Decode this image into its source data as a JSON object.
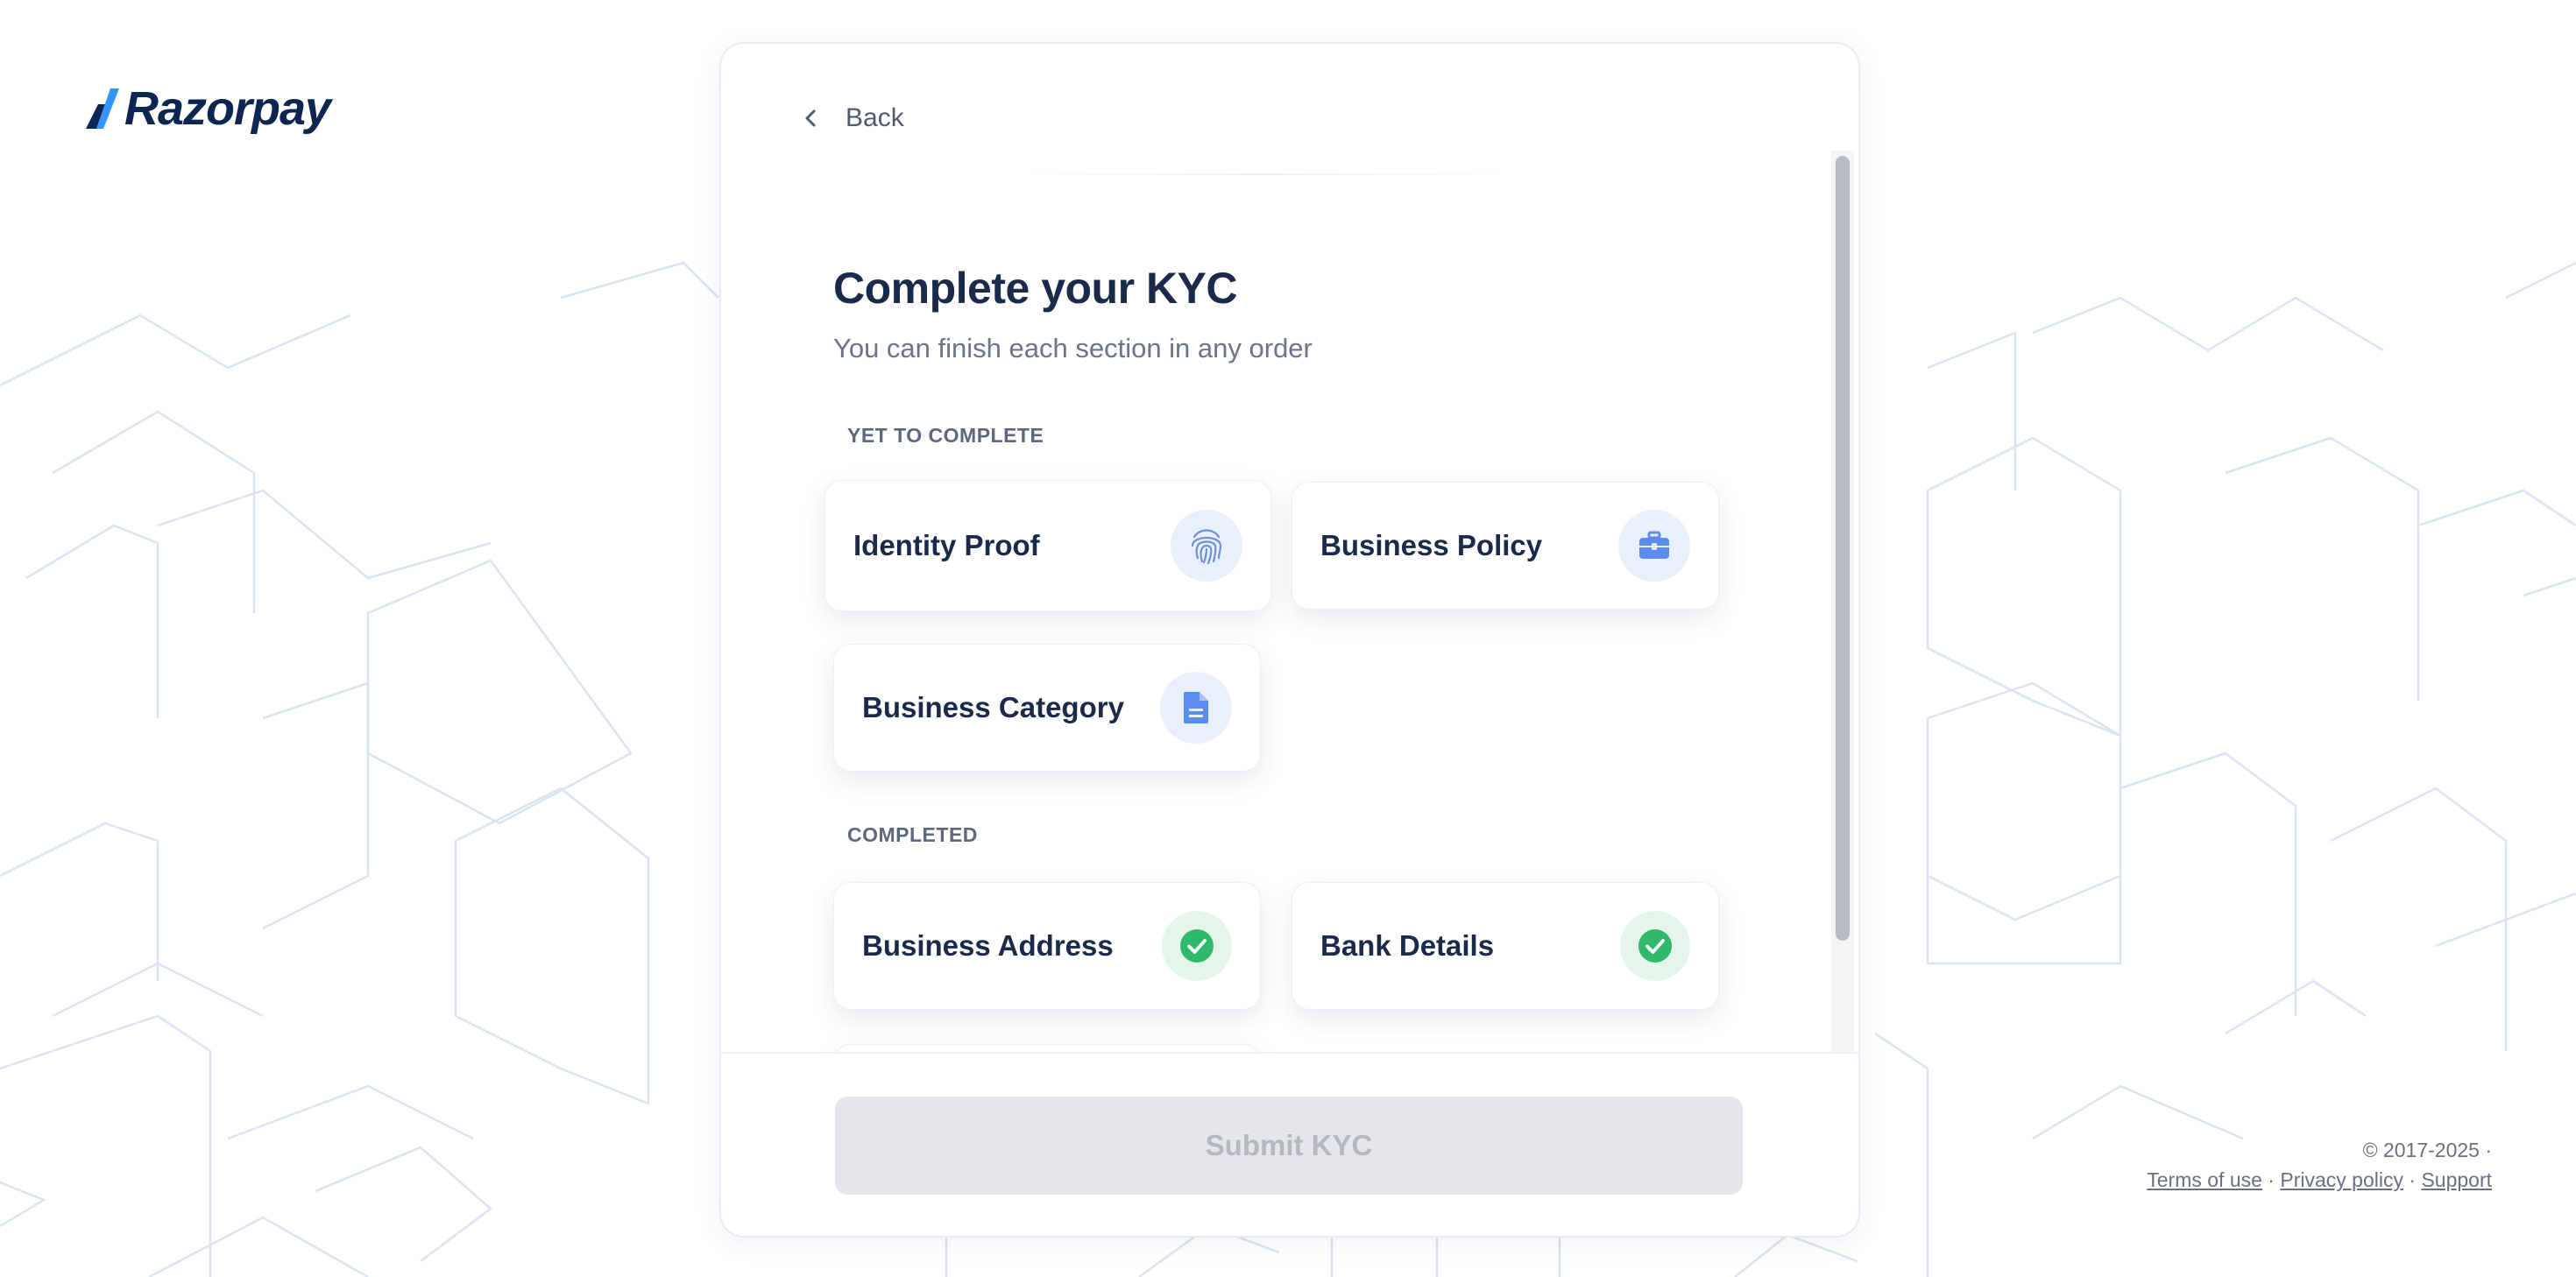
{
  "brand": {
    "name": "Razorpay"
  },
  "nav": {
    "back_label": "Back"
  },
  "page": {
    "title": "Complete your KYC",
    "subtitle": "You can finish each section in any order"
  },
  "sections": {
    "pending_label": "YET TO COMPLETE",
    "completed_label": "COMPLETED"
  },
  "pending_items": [
    {
      "label": "Identity Proof",
      "icon": "fingerprint-icon"
    },
    {
      "label": "Business Policy",
      "icon": "briefcase-icon"
    },
    {
      "label": "Business Category",
      "icon": "document-icon"
    }
  ],
  "completed_items": [
    {
      "label": "Business Address",
      "icon": "check-circle-icon",
      "status": "completed"
    },
    {
      "label": "Bank Details",
      "icon": "check-circle-icon",
      "status": "completed"
    },
    {
      "label": "",
      "icon": "check-circle-icon",
      "status": "completed"
    }
  ],
  "actions": {
    "submit_label": "Submit KYC",
    "submit_enabled": false
  },
  "footer": {
    "copyright": "© 2017-2025 ·",
    "links": [
      "Terms of use",
      "Privacy policy",
      "Support"
    ]
  },
  "colors": {
    "brand_navy": "#0c2651",
    "brand_blue": "#3395ff",
    "icon_blue": "#5b8def",
    "success_green": "#2fb96a",
    "disabled_bg": "#e4e6ea",
    "disabled_text": "#b4b8c1"
  }
}
